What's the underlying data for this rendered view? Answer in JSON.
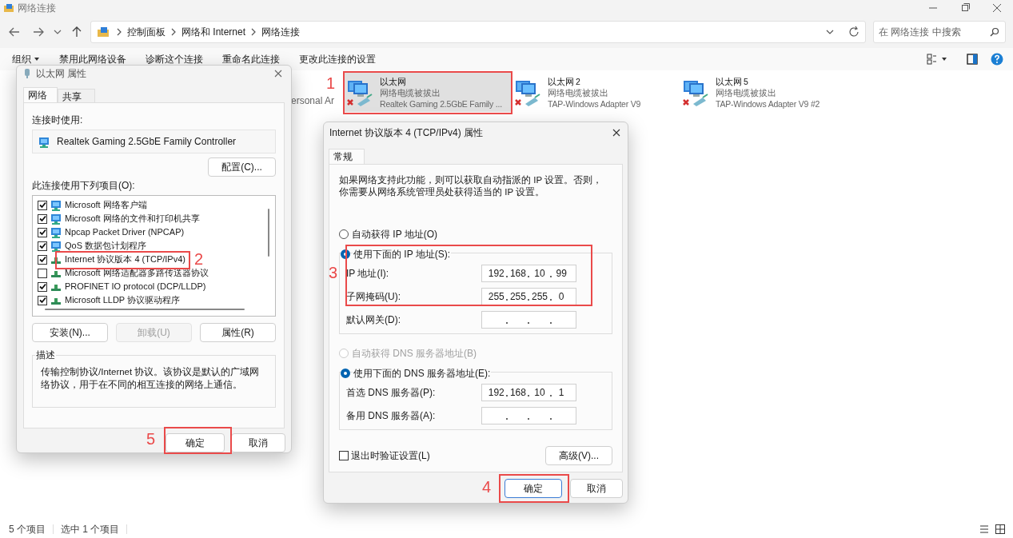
{
  "window": {
    "title": "网络连接"
  },
  "address_bar": {
    "crumbs": [
      "控制面板",
      "网络和 Internet",
      "网络连接"
    ]
  },
  "search": {
    "placeholder": "在 网络连接 中搜索"
  },
  "toolbar": {
    "items": [
      {
        "label": "组织",
        "kind": "menu"
      },
      {
        "label": "禁用此网络设备",
        "kind": "command"
      },
      {
        "label": "诊断这个连接",
        "kind": "command"
      },
      {
        "label": "重命名此连接",
        "kind": "command"
      },
      {
        "label": "更改此连接的设置",
        "kind": "command"
      }
    ]
  },
  "connections": [
    {
      "kind": "partial",
      "device": "ersonal Ar"
    },
    {
      "kind": "adapter",
      "name": "以太网",
      "status": "网络电缆被拔出",
      "device": "Realtek Gaming 2.5GbE Family ...",
      "selected": true
    },
    {
      "kind": "adapter",
      "name": "以太网 2",
      "status": "网络电缆被拔出",
      "device": "TAP-Windows Adapter V9",
      "selected": false
    },
    {
      "kind": "adapter",
      "name": "以太网 5",
      "status": "网络电缆被拔出",
      "device": "TAP-Windows Adapter V9 #2",
      "selected": false
    }
  ],
  "ethernet_properties": {
    "title": "以太网 属性",
    "tabs": [
      {
        "label": "网络",
        "selected": true
      },
      {
        "label": "共享",
        "selected": false
      }
    ],
    "connect_using_label": "连接时使用:",
    "adapter": "Realtek Gaming 2.5GbE Family Controller",
    "configure_button": "配置(C)...",
    "items_label": "此连接使用下列项目(O):",
    "items": [
      {
        "label": "Microsoft 网络客户端",
        "checked": true,
        "kind": "service"
      },
      {
        "label": "Microsoft 网络的文件和打印机共享",
        "checked": true,
        "kind": "service"
      },
      {
        "label": "Npcap Packet Driver (NPCAP)",
        "checked": true,
        "kind": "service"
      },
      {
        "label": "QoS 数据包计划程序",
        "checked": true,
        "kind": "service"
      },
      {
        "label": "Internet 协议版本 4 (TCP/IPv4)",
        "checked": true,
        "kind": "protocol"
      },
      {
        "label": "Microsoft 网络适配器多路传送器协议",
        "checked": false,
        "kind": "protocol"
      },
      {
        "label": "PROFINET IO protocol (DCP/LLDP)",
        "checked": true,
        "kind": "protocol"
      },
      {
        "label": "Microsoft LLDP 协议驱动程序",
        "checked": true,
        "kind": "protocol"
      }
    ],
    "buttons": [
      {
        "label": "安装(N)...",
        "disabled": false
      },
      {
        "label": "卸载(U)",
        "disabled": true
      },
      {
        "label": "属性(R)",
        "disabled": false
      }
    ],
    "description": {
      "title": "描述",
      "text": "传输控制协议/Internet 协议。该协议是默认的广域网络协议，用于在不同的相互连接的网络上通信。"
    },
    "ok": "确定",
    "cancel": "取消"
  },
  "ipv4_properties": {
    "title": "Internet 协议版本 4 (TCP/IPv4) 属性",
    "tabs": [
      {
        "label": "常规",
        "selected": true
      }
    ],
    "intro": "如果网络支持此功能，则可以获取自动指派的 IP 设置。否则，你需要从网络系统管理员处获得适当的 IP 设置。",
    "ip_mode": [
      {
        "label": "自动获得 IP 地址(O)",
        "selected": false,
        "disabled": false
      },
      {
        "label": "使用下面的 IP 地址(S):",
        "selected": true,
        "disabled": false
      }
    ],
    "ip_fields": [
      {
        "label": "IP 地址(I):",
        "octets": [
          "192",
          "168",
          "10",
          "99"
        ]
      },
      {
        "label": "子网掩码(U):",
        "octets": [
          "255",
          "255",
          "255",
          "0"
        ]
      },
      {
        "label": "默认网关(D):"
      }
    ],
    "dns_mode": [
      {
        "label": "自动获得 DNS 服务器地址(B)",
        "selected": false,
        "disabled": true
      },
      {
        "label": "使用下面的 DNS 服务器地址(E):",
        "selected": true,
        "disabled": false
      }
    ],
    "dns_fields": [
      {
        "label": "首选 DNS 服务器(P):",
        "octets": [
          "192",
          "168",
          "10",
          "1"
        ]
      },
      {
        "label": "备用 DNS 服务器(A):"
      }
    ],
    "validate_on_exit": {
      "label": "退出时验证设置(L)",
      "checked": false
    },
    "advanced_button": "高级(V)...",
    "ok": "确定",
    "cancel": "取消"
  },
  "annotations": [
    {
      "label": "1"
    },
    {
      "label": "2"
    },
    {
      "label": "3"
    },
    {
      "label": "4"
    },
    {
      "label": "5"
    }
  ],
  "status_bar": {
    "item_count": "5 个项目",
    "selection": "选中 1 个项目"
  }
}
